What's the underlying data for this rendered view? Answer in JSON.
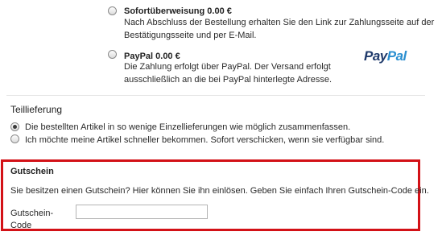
{
  "payment": {
    "sofort": {
      "title": "Sofortüberweisung 0.00 €",
      "desc_line1": "Nach Abschluss der Bestellung erhalten Sie den Link zur Zahlungsseite auf der",
      "desc_line2": "Bestätigungsseite und per E-Mail."
    },
    "paypal": {
      "title": "PayPal 0.00 €",
      "desc_line1": "Die Zahlung erfolgt über PayPal. Der Versand erfolgt",
      "desc_line2": "ausschließlich an die bei PayPal hinterlegte Adresse.",
      "logo_pay": "Pay",
      "logo_pal": "Pal"
    }
  },
  "teillieferung": {
    "heading": "Teillieferung",
    "options": [
      {
        "label": "Die bestellten Artikel in so wenige Einzellieferungen wie möglich zusammenfassen.",
        "checked": true
      },
      {
        "label": "Ich möchte meine Artikel schneller bekommen. Sofort verschicken, wenn sie verfügbar sind.",
        "checked": false
      }
    ]
  },
  "gutschein": {
    "heading": "Gutschein",
    "text": "Sie besitzen einen Gutschein? Hier können Sie ihn einlösen. Geben Sie einfach Ihren Gutschein-Code ein.",
    "field_label_line1": "Gutschein-",
    "field_label_line2": "Code",
    "field_value": ""
  },
  "colors": {
    "highlight_border": "#d31117",
    "paypal_dark": "#1f3a6b",
    "paypal_light": "#2a8fd0"
  }
}
